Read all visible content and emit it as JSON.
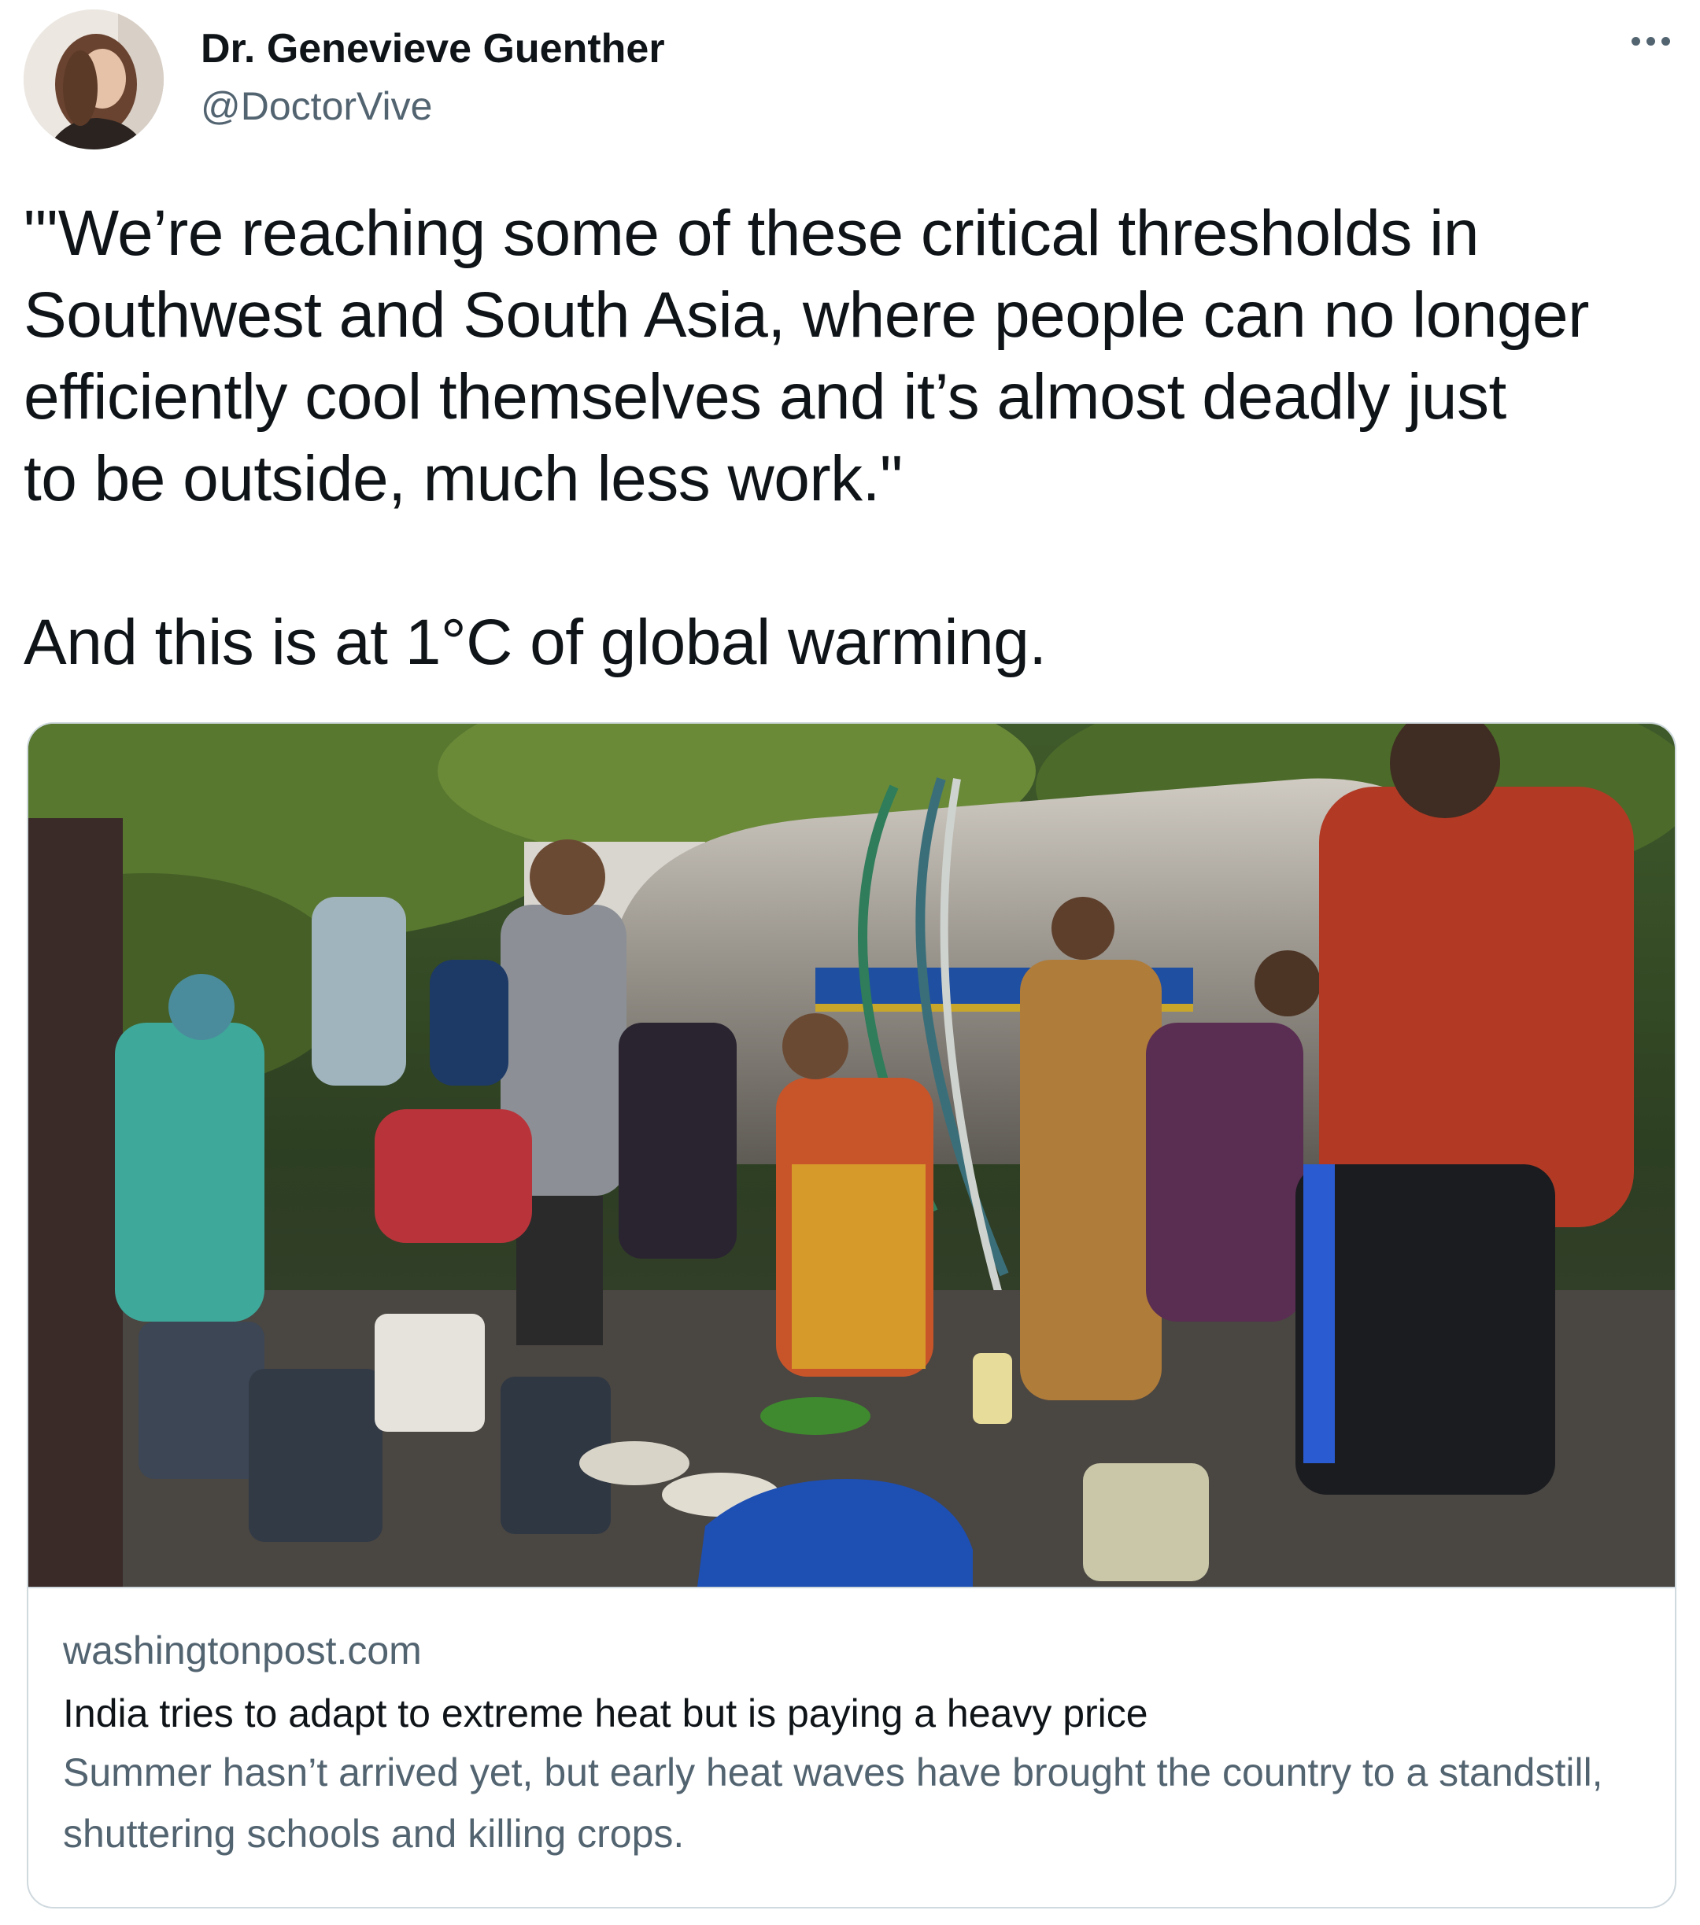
{
  "author": {
    "display_name": "Dr. Genevieve Guenther",
    "handle": "@DoctorVive",
    "avatar_icon": "profile-photo"
  },
  "menu": {
    "icon": "more-dots-icon"
  },
  "tweet": {
    "lines": [
      "\"'We’re reaching some of these critical thresholds in",
      "Southwest and South Asia, where people can no longer",
      "efficiently cool themselves and it’s almost deadly just",
      "to be outside, much less work.\""
    ],
    "closing": "And this is at 1°C of global warming."
  },
  "card": {
    "image_icon": "news-photo",
    "domain": "washingtonpost.com",
    "title": "India tries to adapt to extreme heat but is paying a heavy price",
    "description": "Summer hasn’t arrived yet, but early heat waves have brought the country to a standstill, shuttering schools and killing crops."
  },
  "colors": {
    "text_primary": "#0f1419",
    "text_secondary": "#536471",
    "border": "#cfd9de"
  }
}
